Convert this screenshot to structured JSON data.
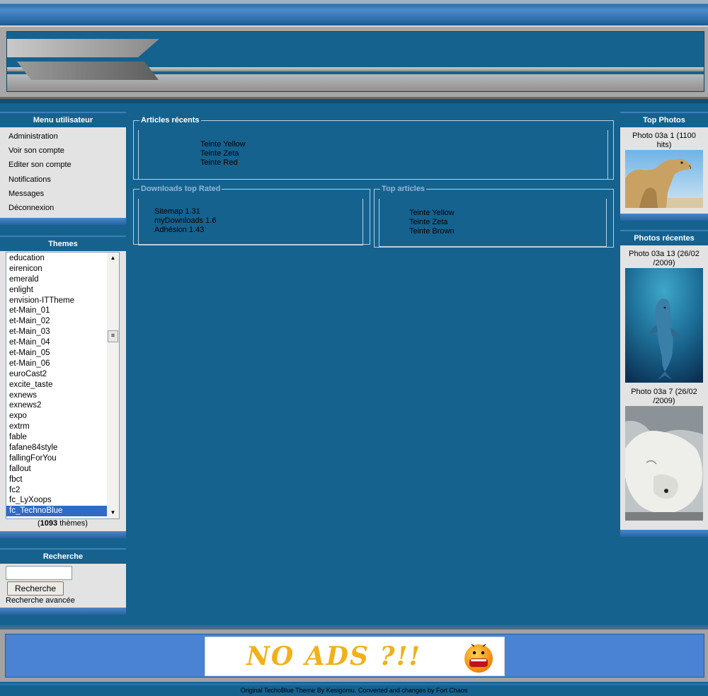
{
  "menu_block": {
    "title": "Menu utilisateur",
    "items": [
      "Administration",
      "Voir son compte",
      "Editer son compte",
      "Notifications",
      "Messages",
      "Déconnexion"
    ]
  },
  "themes_block": {
    "title": "Themes",
    "partial_top": "education...",
    "items": [
      "education",
      "eirenicon",
      "emerald",
      "enlight",
      "envision-ITTheme",
      "et-Main_01",
      "et-Main_02",
      "et-Main_03",
      "et-Main_04",
      "et-Main_05",
      "et-Main_06",
      "euroCast2",
      "excite_taste",
      "exnews",
      "exnews2",
      "expo",
      "extrm",
      "fable",
      "fafane84style",
      "fallingForYou",
      "fallout",
      "fbct",
      "fc2",
      "fc_LyXoops",
      "fc_TechnoBlue"
    ],
    "selected": "fc_TechnoBlue",
    "count_open": "(",
    "count": "1093",
    "count_suffix": " thèmes)"
  },
  "search_block": {
    "title": "Recherche",
    "input_value": "",
    "button_label": "Recherche",
    "advanced_link": "Recherche avancée"
  },
  "recent_articles": {
    "legend": "Articles récents",
    "items": [
      "Teinte Yellow",
      "Teinte Zeta",
      "Teinte Red"
    ]
  },
  "downloads_top": {
    "legend": "Downloads top Rated",
    "items": [
      "Sitemap 1.31",
      "myDownloads 1.6",
      "Adhésion 1.43"
    ]
  },
  "top_articles": {
    "legend": "Top articles",
    "items": [
      "Teinte Yellow",
      "Teinte Zeta",
      "Teinte Brown"
    ]
  },
  "top_photos": {
    "title": "Top Photos",
    "photos": [
      {
        "caption": "Photo 03a 1 (1100 hits)",
        "subject": "camel"
      }
    ]
  },
  "recent_photos": {
    "title": "Photos récentes",
    "photos": [
      {
        "caption": "Photo 03a 13 (26/02 /2009)",
        "subject": "dolphin"
      },
      {
        "caption": "Photo 03a 7 (26/02 /2009)",
        "subject": "polar-bear"
      }
    ]
  },
  "ad_banner": {
    "text": "NO ADS ?!!"
  },
  "footer": {
    "credit": "Original TechoBlue Theme By Kesigomu. Converted and changes by Fort Chaos"
  },
  "colors": {
    "page_bg": "#15628f",
    "block_bg": "#e3e3e3",
    "selected": "#316ac5",
    "foot_blue": "#4a82d4"
  }
}
